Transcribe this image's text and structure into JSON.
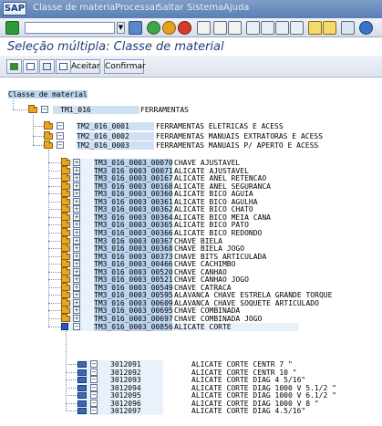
{
  "menu": {
    "items": [
      "Classe de material",
      "Processar",
      "Saltar",
      "Sistema",
      "Ajuda"
    ],
    "sap_icon": "SAP"
  },
  "title": "Seleção múltipla: Classe de material",
  "apptb": {
    "accept": "Aceitar",
    "confirm": "Confirmar"
  },
  "tree": {
    "root_label": "Classe de material",
    "level1": {
      "code": "TM1_016",
      "desc": "FERRAMENTAS"
    },
    "level2": [
      {
        "code": "TM2_016_0001",
        "desc": "FERRAMENTAS ELETRICAS E ACESS"
      },
      {
        "code": "TM2_016_0002",
        "desc": "FERRAMENTAS MANUAIS EXTRATORAS E ACESS"
      },
      {
        "code": "TM2_016_0003",
        "desc": "FERRAMENTAS MANUAIS P/ APERTO E ACESS"
      }
    ],
    "level3": [
      {
        "code": "TM3_016_0003_00070",
        "desc": "CHAVE AJUSTAVEL"
      },
      {
        "code": "TM3_016_0003_00071",
        "desc": "ALICATE AJUSTAVEL"
      },
      {
        "code": "TM3_016_0003_00167",
        "desc": "ALICATE ANEL RETENCAO"
      },
      {
        "code": "TM3_016_0003_00168",
        "desc": "ALICATE ANEL SEGURANCA"
      },
      {
        "code": "TM3_016_0003_00360",
        "desc": "ALICATE BICO AGUIA"
      },
      {
        "code": "TM3_016_0003_00361",
        "desc": "ALICATE BICO AGULHA"
      },
      {
        "code": "TM3_016_0003_00362",
        "desc": "ALICATE BICO CHATO"
      },
      {
        "code": "TM3_016_0003_00364",
        "desc": "ALICATE BICO MEIA CANA"
      },
      {
        "code": "TM3_016_0003_00365",
        "desc": "ALICATE BICO PATO"
      },
      {
        "code": "TM3_016_0003_00366",
        "desc": "ALICATE BICO REDONDO"
      },
      {
        "code": "TM3_016_0003_00367",
        "desc": "CHAVE BIELA"
      },
      {
        "code": "TM3_016_0003_00368",
        "desc": "CHAVE BIELA JOGO"
      },
      {
        "code": "TM3_016_0003_00373",
        "desc": "CHAVE BITS ARTICULADA"
      },
      {
        "code": "TM3_016_0003_00466",
        "desc": "CHAVE CACHIMBO"
      },
      {
        "code": "TM3_016_0003_00520",
        "desc": "CHAVE CANHAO"
      },
      {
        "code": "TM3_016_0003_00521",
        "desc": "CHAVE CANHAO JOGO"
      },
      {
        "code": "TM3_016_0003_00549",
        "desc": "CHAVE CATRACA"
      },
      {
        "code": "TM3_016_0003_00595",
        "desc": "ALAVANCA CHAVE ESTRELA GRANDE TORQUE"
      },
      {
        "code": "TM3_016_0003_00609",
        "desc": "ALAVANCA CHAVE SOQUETE ARTICULADO"
      },
      {
        "code": "TM3_016_0003_00695",
        "desc": "CHAVE COMBINADA"
      },
      {
        "code": "TM3_016_0003_00697",
        "desc": "CHAVE COMBINADA JOGO"
      },
      {
        "code": "TM3_016_0003_00856",
        "desc": "ALICATE CORTE"
      }
    ],
    "level4": [
      {
        "code": "3012091",
        "desc": "ALICATE CORTE CENTR 7 \""
      },
      {
        "code": "3012092",
        "desc": "ALICATE CORTE CENTR 10 \""
      },
      {
        "code": "3012093",
        "desc": "ALICATE CORTE DIAG 4 5/16\""
      },
      {
        "code": "3012094",
        "desc": "ALICATE CORTE DIAG 1000 V 5.1/2 \""
      },
      {
        "code": "3012095",
        "desc": "ALICATE CORTE DIAG 1000 V 6.1/2 \""
      },
      {
        "code": "3012096",
        "desc": "ALICATE CORTE DIAG 1000 V 8 \""
      },
      {
        "code": "3012097",
        "desc": "ALICATE CORTE DIAG 4.5/16\""
      }
    ]
  }
}
